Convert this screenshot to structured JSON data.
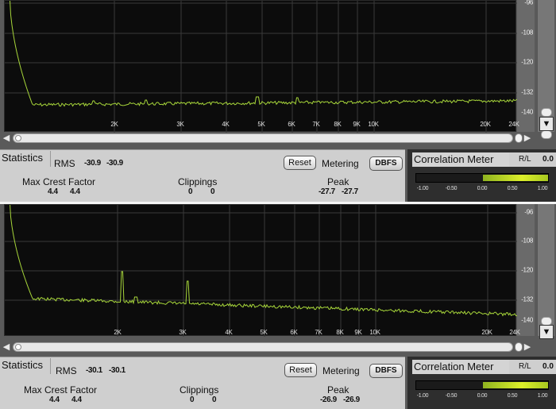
{
  "colors": {
    "trace": "#a7d63a",
    "grid": "#3a3a3a",
    "plot_bg": "#0c0c0c",
    "correlation_bar": "#d4ec2c"
  },
  "y_axis_labels": [
    "-96",
    "-108",
    "-120",
    "-132",
    "-140"
  ],
  "x_axis_labels": [
    "2K",
    "3K",
    "4K",
    "5K",
    "6K",
    "7K",
    "8K",
    "9K",
    "10K",
    "20K",
    "24K"
  ],
  "correlation_ticks": [
    "-1.00",
    "-0.50",
    "0.00",
    "0.50",
    "1.00"
  ],
  "panels": [
    {
      "statistics_tab": "Statistics",
      "rms_label": "RMS",
      "rms_left": "-30.9",
      "rms_right": "-30.9",
      "reset_label": "Reset",
      "metering_label": "Metering",
      "metering_mode": "DBFS",
      "max_crest_label": "Max Crest Factor",
      "crest_left": "4.4",
      "crest_right": "4.4",
      "clippings_label": "Clippings",
      "clip_left": "0",
      "clip_right": "0",
      "peak_label": "Peak",
      "peak_left": "-27.7",
      "peak_right": "-27.7",
      "correlation_title": "Correlation Meter",
      "rl_label": "R/L",
      "rl_value": "0.0",
      "correlation_level": 0.0,
      "scroll_left_icon": "triangle-left-icon",
      "scroll_right_icon": "triangle-right-icon",
      "scroll_down_icon": "triangle-down-icon"
    },
    {
      "statistics_tab": "Statistics",
      "rms_label": "RMS",
      "rms_left": "-30.1",
      "rms_right": "-30.1",
      "reset_label": "Reset",
      "metering_label": "Metering",
      "metering_mode": "DBFS",
      "max_crest_label": "Max Crest Factor",
      "crest_left": "4.4",
      "crest_right": "4.4",
      "clippings_label": "Clippings",
      "clip_left": "0",
      "clip_right": "0",
      "peak_label": "Peak",
      "peak_left": "-26.9",
      "peak_right": "-26.9",
      "correlation_title": "Correlation Meter",
      "rl_label": "R/L",
      "rl_value": "0.0",
      "correlation_level": 0.0,
      "scroll_left_icon": "triangle-left-icon",
      "scroll_right_icon": "triangle-right-icon",
      "scroll_down_icon": "triangle-down-icon"
    }
  ]
}
